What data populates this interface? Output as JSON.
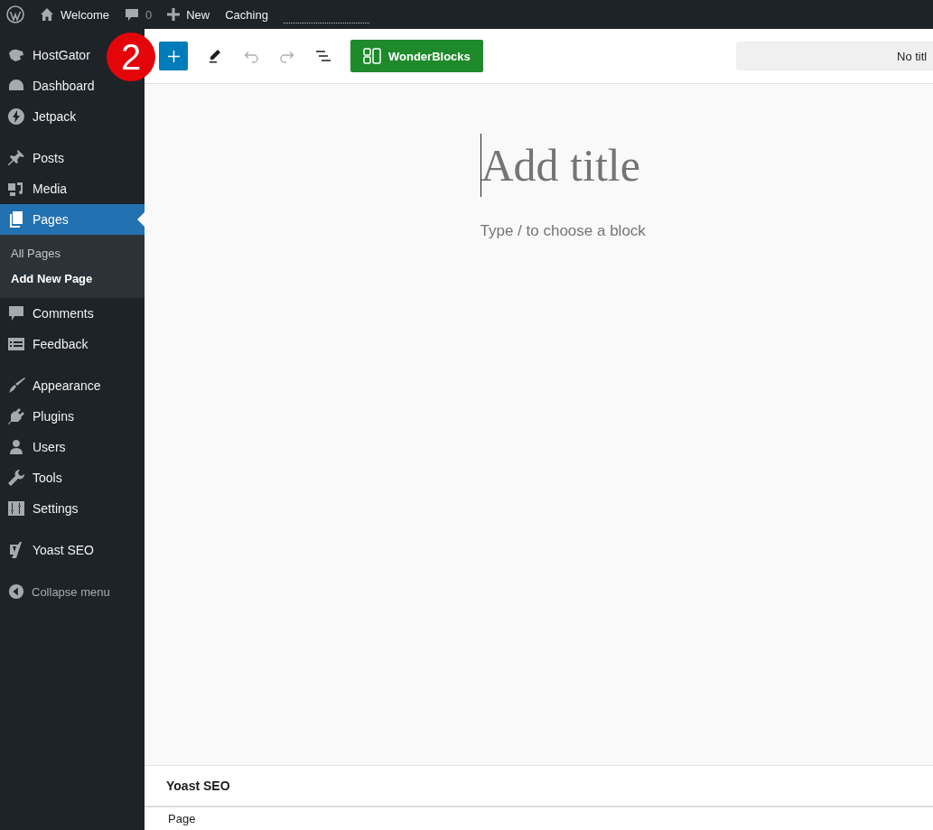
{
  "admin_bar": {
    "site": "Welcome",
    "comments_count": "0",
    "new": "New",
    "caching": "Caching"
  },
  "sidebar": {
    "groups": [
      {
        "items": [
          {
            "label": "HostGator",
            "selected": false
          },
          {
            "label": "Dashboard",
            "selected": false
          },
          {
            "label": "Jetpack",
            "selected": false
          }
        ]
      },
      {
        "items": [
          {
            "label": "Posts",
            "selected": false
          },
          {
            "label": "Media",
            "selected": false
          },
          {
            "label": "Pages",
            "selected": true,
            "children": [
              {
                "label": "All Pages",
                "selected": false
              },
              {
                "label": "Add New Page",
                "selected": true
              }
            ]
          },
          {
            "label": "Comments",
            "selected": false
          },
          {
            "label": "Feedback",
            "selected": false
          }
        ]
      },
      {
        "items": [
          {
            "label": "Appearance",
            "selected": false
          },
          {
            "label": "Plugins",
            "selected": false
          },
          {
            "label": "Users",
            "selected": false
          },
          {
            "label": "Tools",
            "selected": false
          },
          {
            "label": "Settings",
            "selected": false
          }
        ]
      },
      {
        "items": [
          {
            "label": "Yoast SEO",
            "selected": false
          }
        ]
      }
    ],
    "collapse": "Collapse menu"
  },
  "step_badge": "2",
  "toolbar": {
    "wonderblocks": "WonderBlocks",
    "document_title": "No titl"
  },
  "editor": {
    "title": {
      "placeholder": "Add title"
    },
    "block": {
      "placeholder": "Type / to choose a block"
    }
  },
  "meta_panel": {
    "title": "Yoast SEO"
  },
  "footer": {
    "breadcrumb": "Page"
  }
}
